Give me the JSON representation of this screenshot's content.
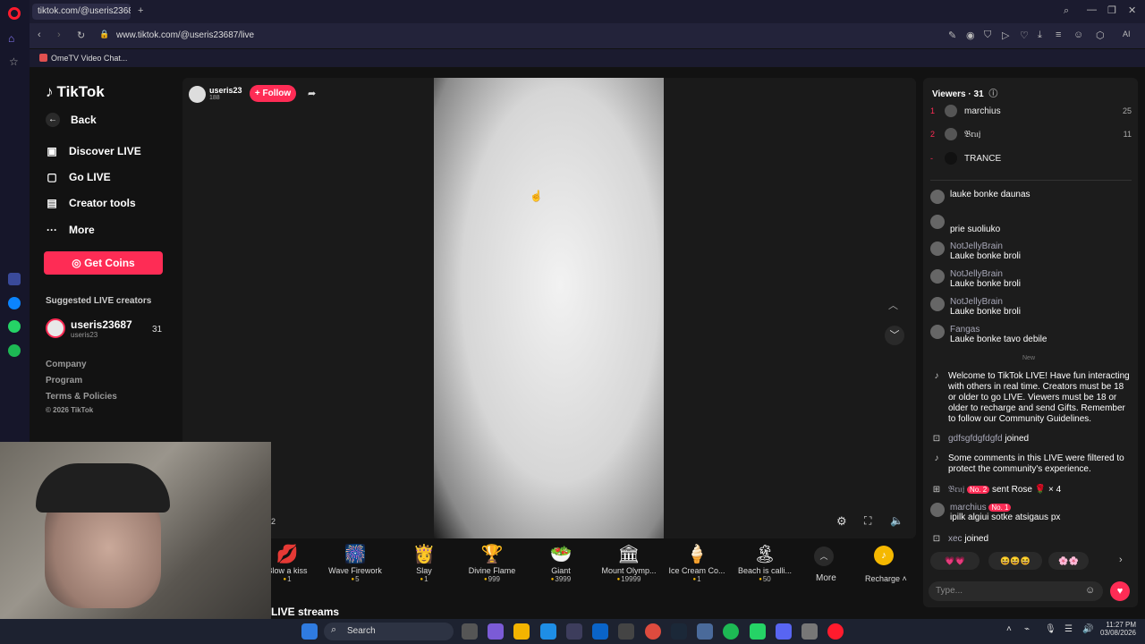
{
  "browser": {
    "tab_title": "tiktok.com/@useris23687",
    "url": "www.tiktok.com/@useris23687/live",
    "bookmark": "OmeTV Video Chat..."
  },
  "sidebar": {
    "logo": "TikTok",
    "back": "Back",
    "items": [
      {
        "label": "Discover LIVE"
      },
      {
        "label": "Go LIVE"
      },
      {
        "label": "Creator tools"
      },
      {
        "label": "More"
      }
    ],
    "get_coins": "Get Coins",
    "suggested_title": "Suggested LIVE creators",
    "creator": {
      "name": "useris23687",
      "handle": "useris23",
      "count": "31"
    },
    "footer": [
      "Company",
      "Program",
      "Terms & Policies",
      "© 2026 TikTok"
    ]
  },
  "stream": {
    "host_name": "useris23",
    "host_likes": "188",
    "follow": "+ Follow",
    "corner_text": "2",
    "live_streams": "LIVE streams"
  },
  "gifts": [
    {
      "name": "Blow a kiss",
      "price": "1",
      "icon": "💋"
    },
    {
      "name": "Wave Firework",
      "price": "5",
      "icon": "🎆"
    },
    {
      "name": "Slay",
      "price": "1",
      "icon": "👸"
    },
    {
      "name": "Divine Flame",
      "price": "999",
      "icon": "🏆"
    },
    {
      "name": "Giant",
      "price": "3999",
      "icon": "🥗"
    },
    {
      "name": "Mount Olymp...",
      "price": "19999",
      "icon": "🏛"
    },
    {
      "name": "Ice Cream Co...",
      "price": "1",
      "icon": "🍦"
    },
    {
      "name": "Beach is calli...",
      "price": "50",
      "icon": "🏝"
    }
  ],
  "gifts_more": "More",
  "recharge": "Recharge",
  "viewers": {
    "title": "Viewers · 31",
    "list": [
      {
        "rank": "1",
        "name": "marchius",
        "score": "25"
      },
      {
        "rank": "2",
        "name": "𝔅𝔯𝔲𝔧",
        "score": "11"
      },
      {
        "rank": "-",
        "name": "TRANCE",
        "score": ""
      }
    ]
  },
  "chat": [
    {
      "name": "",
      "text": "lauke bonke daunas"
    },
    {
      "name": "",
      "text": "prie suoliuko"
    },
    {
      "name": "NotJellyBrain",
      "text": "Lauke bonke broli"
    },
    {
      "name": "NotJellyBrain",
      "text": "Lauke bonke broli"
    },
    {
      "name": "NotJellyBrain",
      "text": "Lauke bonke broli"
    },
    {
      "name": "Fangas",
      "text": "Lauke bonke tavo debile"
    }
  ],
  "new_label": "New",
  "system": {
    "welcome": "Welcome to TikTok LIVE! Have fun interacting with others in real time. Creators must be 18 or older to go LIVE. Viewers must be 18 or older to recharge and send Gifts. Remember to follow our Community Guidelines.",
    "joined1_name": "gdfsgfdgfdgfd",
    "joined": "joined",
    "filtered": "Some comments in this LIVE were filtered to protect the community's experience.",
    "gift_user": "𝔅𝔯𝔲𝔧",
    "gift_badge": "No. 2",
    "gift_text": "sent Rose",
    "gift_count": "× 4",
    "marchius_name": "marchius",
    "marchius_badge": "No. 1",
    "marchius_text": "ipilk algiui sotke atsigaus px",
    "joined2_name": "xec"
  },
  "input_placeholder": "Type...",
  "taskbar": {
    "search": "Search",
    "time": "11:27 PM",
    "date": "03/08/2026"
  },
  "colors": {
    "accent": "#fe2c55",
    "panel": "#1c1c1c",
    "background": "#121212"
  }
}
